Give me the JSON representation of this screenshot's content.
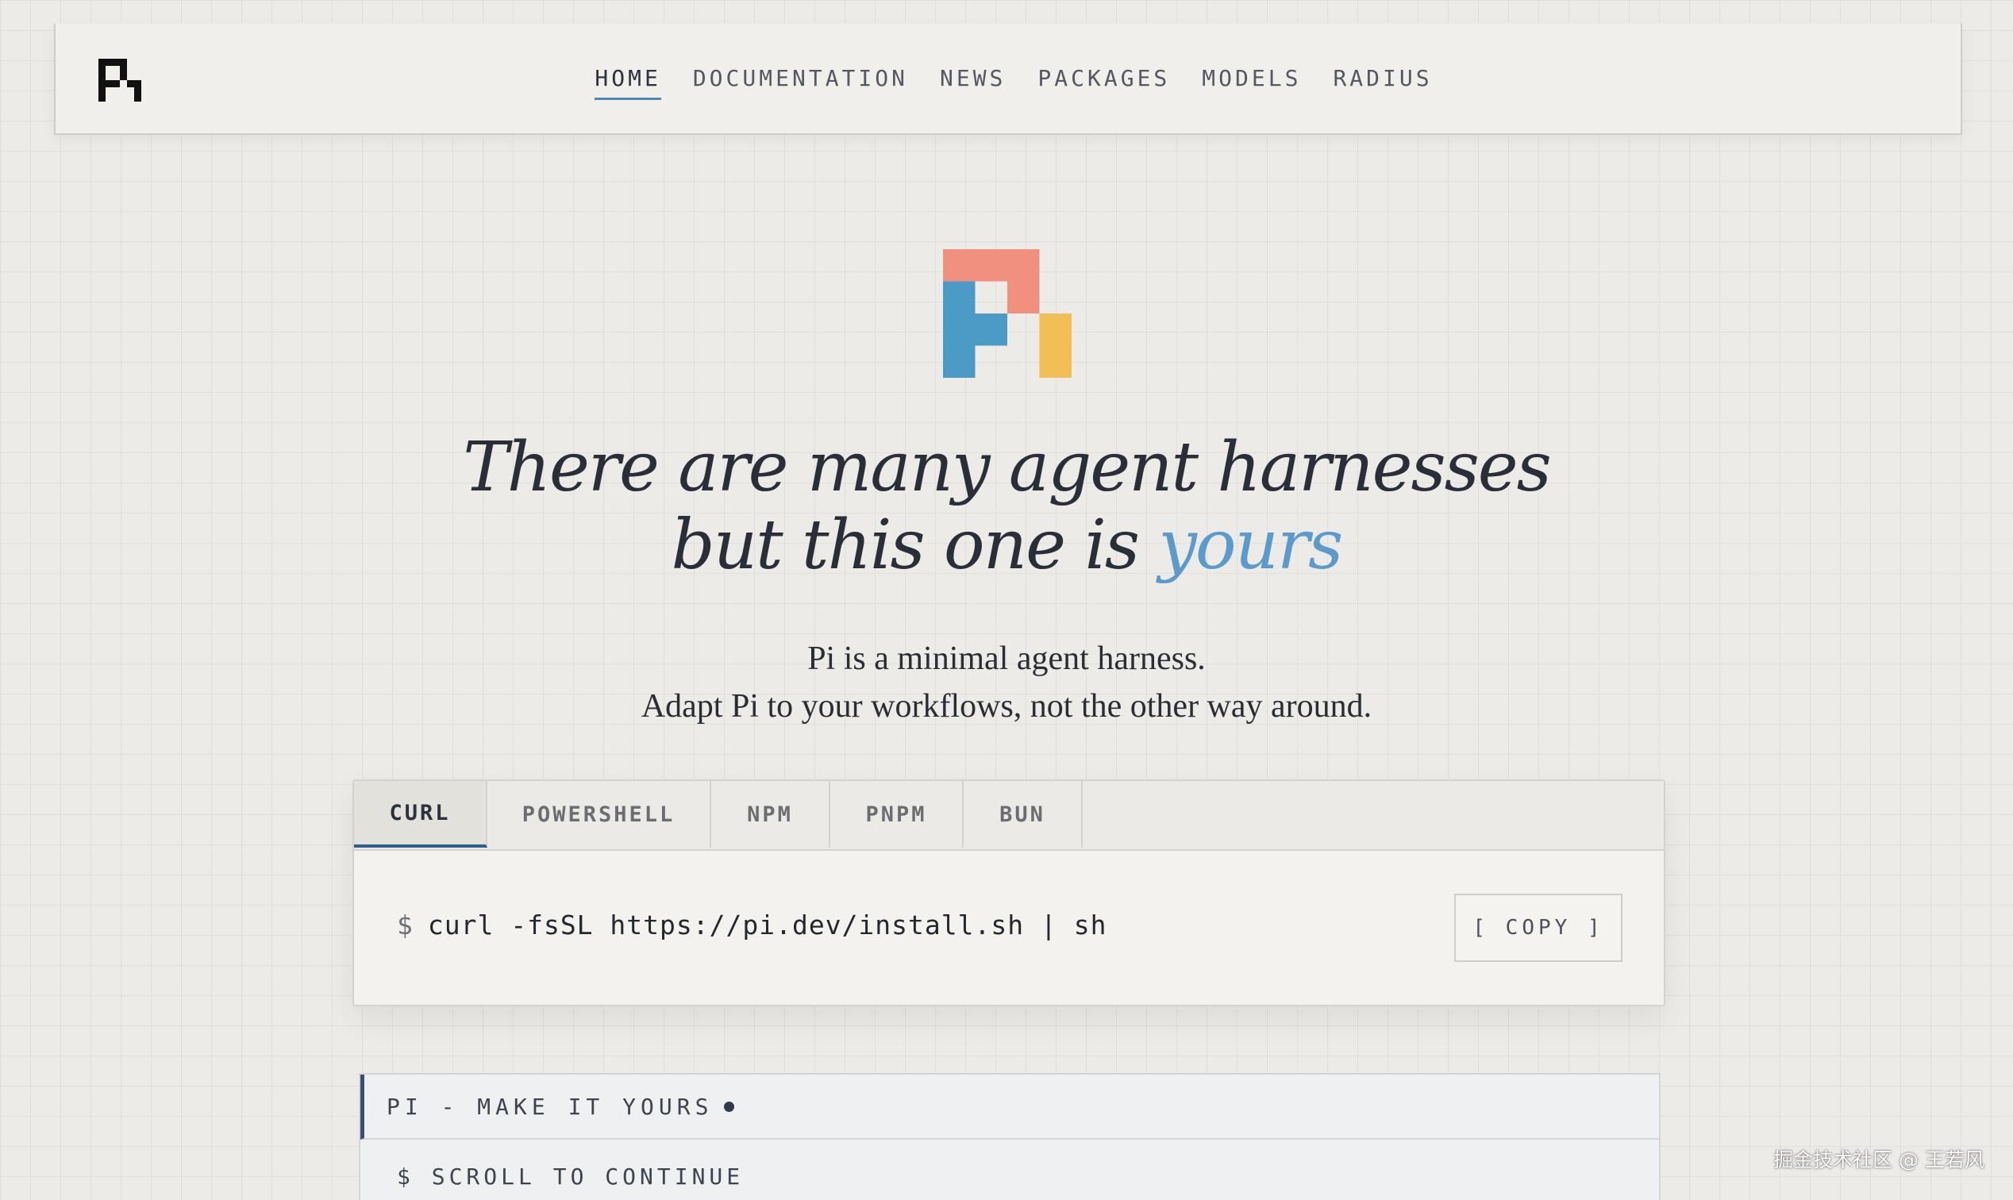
{
  "nav": {
    "logo_icon": "pi-logo-icon",
    "items": [
      {
        "label": "HOME",
        "active": true
      },
      {
        "label": "DOCUMENTATION",
        "active": false
      },
      {
        "label": "NEWS",
        "active": false
      },
      {
        "label": "PACKAGES",
        "active": false
      },
      {
        "label": "MODELS",
        "active": false
      },
      {
        "label": "RADIUS",
        "active": false
      }
    ]
  },
  "hero": {
    "logo_icon": "pi-color-logo-icon",
    "logo_colors": {
      "salmon": "#f0907f",
      "blue": "#4b9bc6",
      "yellow": "#f2be56"
    },
    "headline_line1": "There are many agent harnesses",
    "headline_line2_prefix": "but this one is",
    "headline_line2_accent": "yours",
    "accent_color": "#5b9ac9",
    "subtext_line1": "Pi is a minimal agent harness.",
    "subtext_line2": "Adapt Pi to your workflows, not the other way around."
  },
  "install": {
    "tabs": [
      {
        "label": "CURL",
        "active": true
      },
      {
        "label": "POWERSHELL",
        "active": false
      },
      {
        "label": "NPM",
        "active": false
      },
      {
        "label": "PNPM",
        "active": false
      },
      {
        "label": "BUN",
        "active": false
      }
    ],
    "prompt": "$",
    "command": "curl -fsSL https://pi.dev/install.sh | sh",
    "copy_label": "[ COPY ]"
  },
  "terminal": {
    "title": "PI - MAKE IT YOURS",
    "body": "$ SCROLL TO CONTINUE"
  },
  "watermark": "掘金技术社区 @ 王若风"
}
